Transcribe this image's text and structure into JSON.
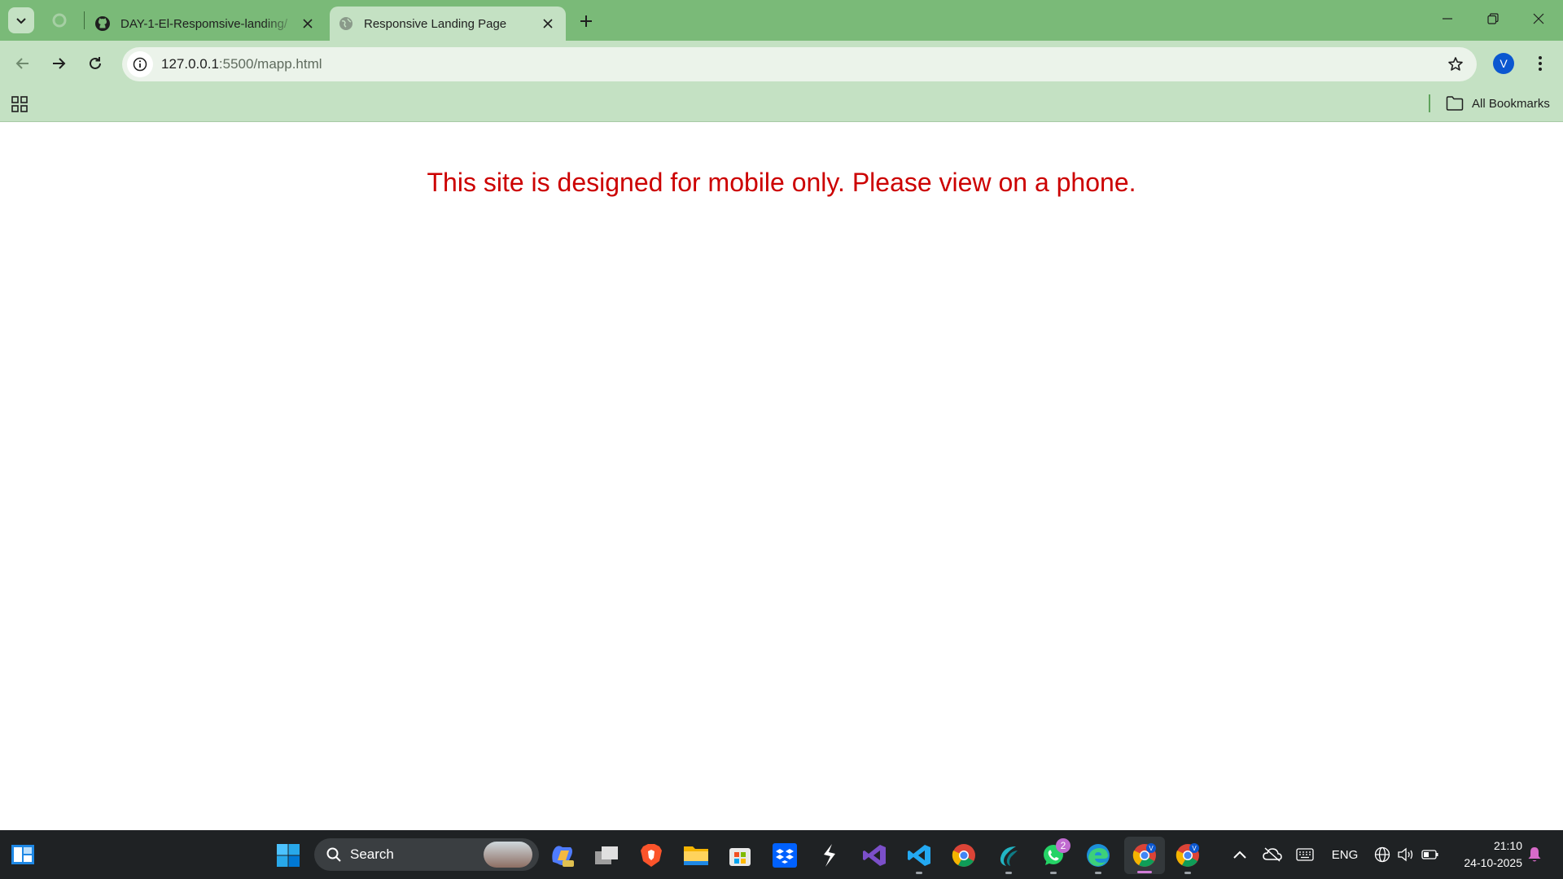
{
  "browser": {
    "tabs": [
      {
        "title": "DAY-1-El-Respomsive-landing/",
        "icon": "github-icon",
        "active": false
      },
      {
        "title": "Responsive Landing Page",
        "icon": "globe-icon",
        "active": true
      }
    ],
    "url_host": "127.0.0.1",
    "url_path": ":5500/mapp.html",
    "profile_initial": "V",
    "bookmarks_label": "All Bookmarks"
  },
  "page": {
    "message": "This site is designed for mobile only. Please view on a phone."
  },
  "taskbar": {
    "search_label": "Search",
    "whatsapp_badge": "2",
    "language": "ENG",
    "time": "21:10",
    "date": "24-10-2025",
    "apps": [
      "copilot-icon",
      "task-view-icon",
      "brave-icon",
      "file-explorer-icon",
      "microsoft-store-icon",
      "dropbox-icon",
      "sumatra-icon",
      "visual-studio-icon",
      "vscode-icon",
      "chrome-icon",
      "wave-app-icon",
      "whatsapp-icon",
      "edge-icon",
      "chrome-profile-icon",
      "chrome-profile-2-icon"
    ]
  },
  "colors": {
    "tabstrip": "#7aba78",
    "toolbar": "#c4e1c3",
    "message": "#cc0000",
    "taskbar": "#1f2224"
  }
}
